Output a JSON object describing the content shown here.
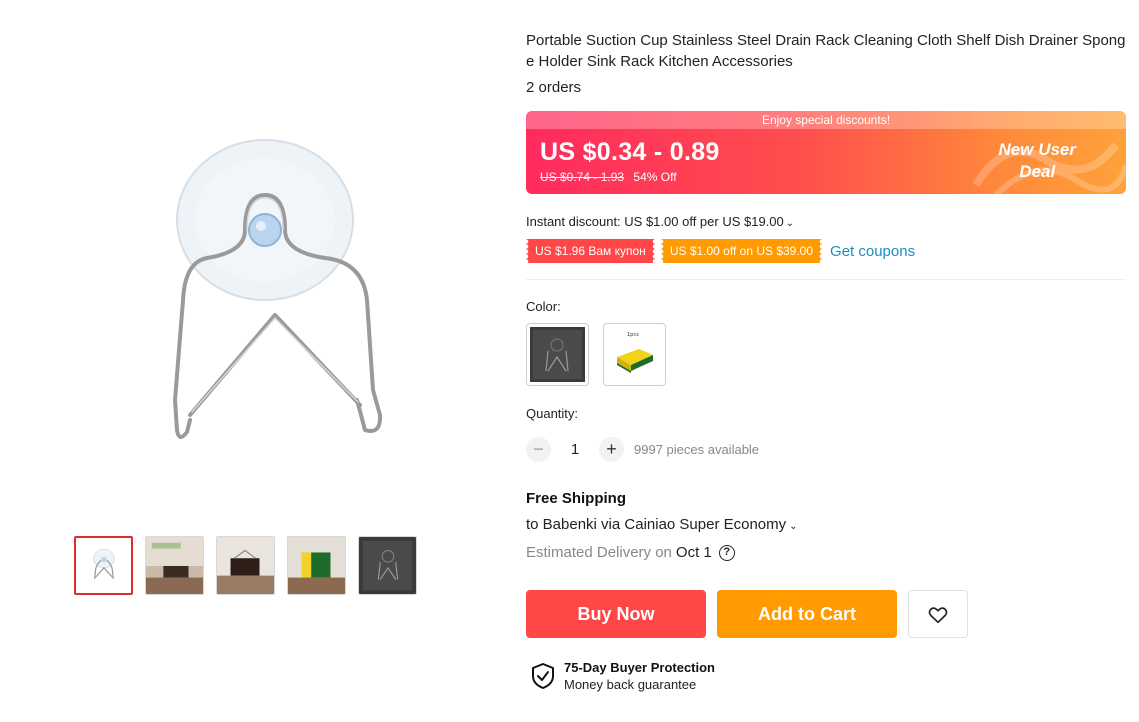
{
  "product": {
    "title": "Portable Suction Cup Stainless Steel Drain Rack Cleaning Cloth Shelf Dish Drainer Sponge Holder Sink Rack Kitchen Accessories",
    "orders": "2 orders"
  },
  "gallery": {
    "thumbnails": [
      "suction-hook",
      "rack-with-sponge-wall",
      "rack-with-sponge-dark",
      "rack-with-yellow-sponge",
      "rack-on-dark"
    ]
  },
  "price": {
    "banner_text": "Enjoy special discounts!",
    "current": "US $0.34 - 0.89",
    "original": "US $0.74 - 1.93",
    "discount": "54% Off",
    "deal_line1": "New User",
    "deal_line2": "Deal"
  },
  "discount": {
    "instant": "Instant discount: US $1.00 off per US $19.00",
    "coupon_red": "US $1.96 Вам купон",
    "coupon_orange": "US $1.00 off on US $39.00",
    "get_coupons": "Get coupons"
  },
  "options": {
    "color_label": "Color:",
    "swatches": [
      "dark-rack",
      "sponge-1pcs"
    ],
    "swatch_caption": "1pcs"
  },
  "quantity": {
    "label": "Quantity:",
    "minus": "−",
    "plus": "+",
    "value": "1",
    "available": "9997 pieces available"
  },
  "shipping": {
    "title": "Free Shipping",
    "to": "to Babenki via Cainiao Super Economy",
    "eta_label": "Estimated Delivery on",
    "eta_date": "Oct 1",
    "help": "?"
  },
  "actions": {
    "buy_now": "Buy Now",
    "add_to_cart": "Add to Cart"
  },
  "protection": {
    "title": "75-Day Buyer Protection",
    "subtitle": "Money back guarantee"
  },
  "colors": {
    "buy": "#ff4747",
    "cart": "#ff9a00",
    "link": "#1a8fbf",
    "active_thumb": "#e02b2b"
  }
}
